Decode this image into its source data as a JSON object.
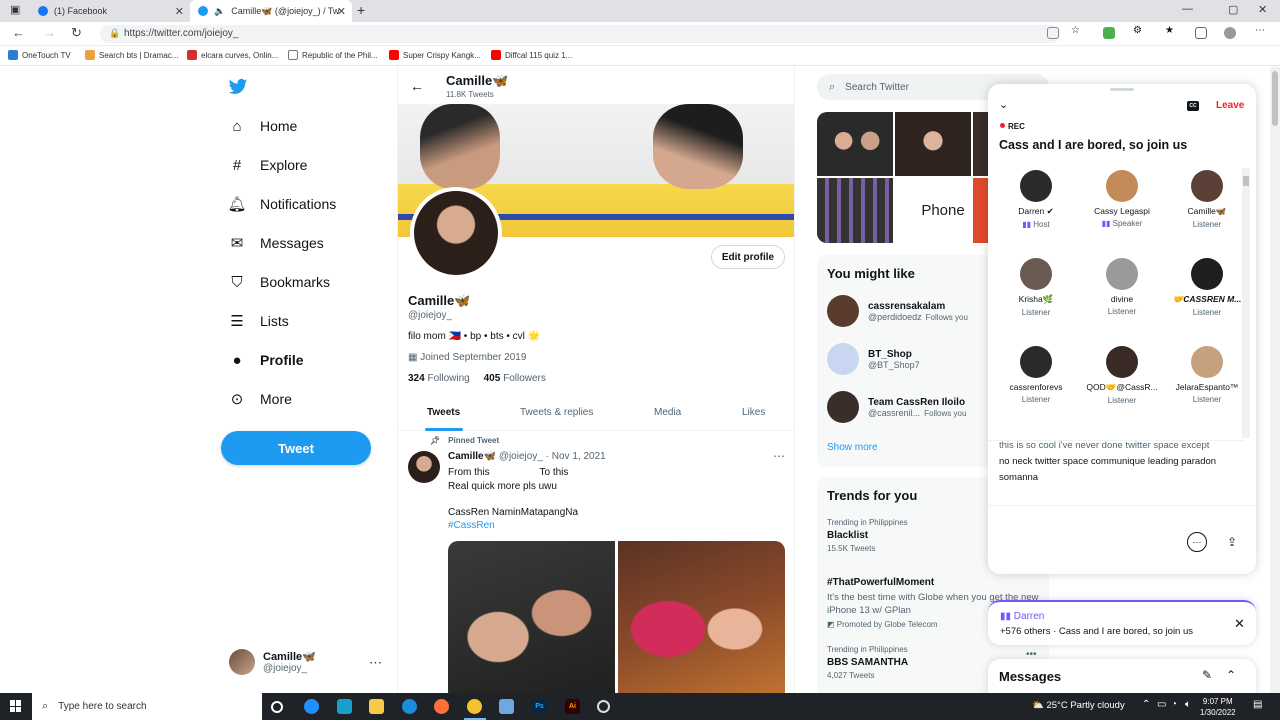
{
  "browser": {
    "tabs": [
      {
        "title": "(1) Facebook",
        "favicon_color": "#1877f2"
      },
      {
        "title": "Camille🦋 (@joiejoy_) / Tw",
        "favicon_color": "#1d9bf0",
        "active": true
      }
    ],
    "url": "https://twitter.com/joiejoy_",
    "bookmarks": [
      {
        "label": "OneTouch TV",
        "color": "#2e7cd6"
      },
      {
        "label": "Search bts | Dramac...",
        "color": "#e8a33c"
      },
      {
        "label": "elcara curves, Onlin...",
        "color": "#d62d2d"
      },
      {
        "label": "Republic of the Phil...",
        "color": "#777777"
      },
      {
        "label": "Super Crispy Kangk...",
        "color": "#ff0000"
      },
      {
        "label": "Diffcal 115 quiz 1...",
        "color": "#ff0000"
      }
    ]
  },
  "nav": {
    "items": [
      {
        "label": "Home",
        "icon": "home-icon"
      },
      {
        "label": "Explore",
        "icon": "hashtag-icon"
      },
      {
        "label": "Notifications",
        "icon": "bell-icon"
      },
      {
        "label": "Messages",
        "icon": "envelope-icon"
      },
      {
        "label": "Bookmarks",
        "icon": "bookmark-icon"
      },
      {
        "label": "Lists",
        "icon": "list-icon"
      },
      {
        "label": "Profile",
        "icon": "person-icon",
        "active": true
      },
      {
        "label": "More",
        "icon": "more-circle-icon"
      }
    ],
    "tweet_button": "Tweet",
    "account": {
      "name": "Camille🦋",
      "handle": "@joiejoy_"
    }
  },
  "profile": {
    "header_name": "Camille🦋",
    "tweet_count": "11.8K Tweets",
    "edit_button": "Edit profile",
    "name": "Camille🦋",
    "handle": "@joiejoy_",
    "bio": "filo mom 🇵🇭 • bp • bts • cvl 🌟",
    "joined": "Joined September 2019",
    "following_count": "324",
    "following_label": "Following",
    "followers_count": "405",
    "followers_label": "Followers",
    "tabs": [
      "Tweets",
      "Tweets & replies",
      "Media",
      "Likes"
    ]
  },
  "pinned_tweet": {
    "label": "Pinned Tweet",
    "name": "Camille🦋",
    "meta": "@joiejoy_ · Nov 1, 2021",
    "lines": [
      "From this                  To this",
      "Real quick more pls uwu",
      "",
      "CassRen NaminMatapangNa"
    ],
    "hashtag": "#CassRen"
  },
  "right": {
    "search_placeholder": "Search Twitter",
    "media_text": "Phone",
    "might_like": {
      "title": "You might like",
      "people": [
        {
          "name": "cassrensakalam",
          "handle": "@perdidoedz",
          "follows_you": "Follows you",
          "color": "#5a3b2e"
        },
        {
          "name": "BT_Shop",
          "handle": "@BT_Shop7",
          "follows_you": "",
          "color": "#c9d6f2"
        },
        {
          "name": "Team CassRen Iloilo",
          "handle": "@cassrenil...",
          "follows_you": "Follows you",
          "color": "#3a2e2a"
        }
      ],
      "show_more": "Show more"
    },
    "trends": {
      "title": "Trends for you",
      "items": [
        {
          "context": "Trending in Philippines",
          "name": "Blacklist",
          "count": "15.5K Tweets"
        },
        {
          "context": "",
          "name": "#ThatPowerfulMoment",
          "desc": "It's the best time with Globe when you get the new iPhone 13 w/ GPlan",
          "promo": "Promoted by Globe Telecom"
        },
        {
          "context": "Trending in Philippines",
          "name": "BBS SAMANTHA",
          "count": "4,027 Tweets"
        }
      ]
    }
  },
  "space": {
    "leave": "Leave",
    "cc": "CC",
    "rec": "REC",
    "title": "Cass and I are bored, so join us",
    "participants": [
      {
        "name": "Darren ✔",
        "role": "Host",
        "color": "#2b2b2b"
      },
      {
        "name": "Cassy Legaspi",
        "role": "Speaker",
        "color": "#c48a5a"
      },
      {
        "name": "Camille🦋",
        "role": "Listener",
        "color": "#5a4036"
      },
      {
        "name": "Krisha🌿",
        "role": "Listener",
        "color": "#6a5a52"
      },
      {
        "name": "divine",
        "role": "Listener",
        "color": "#9a9a9a"
      },
      {
        "name": "🤝CASSREN M...",
        "role": "Listener",
        "color": "#1f1f1f"
      },
      {
        "name": "cassrenforevs",
        "role": "Listener",
        "color": "#2a2a2a"
      },
      {
        "name": "QOD🤝@CassR...",
        "role": "Listener",
        "color": "#3a2a26"
      },
      {
        "name": "JelaraEspanto™",
        "role": "Listener",
        "color": "#c7a07e"
      }
    ],
    "caption1": "this is so cool i've never done twitter space except",
    "caption2": "no neck twitter space communique leading paradon somanna",
    "dock_host": "Darren",
    "dock_sub": "+576 others · Cass and I are bored, so join us"
  },
  "messages": {
    "title": "Messages"
  },
  "taskbar": {
    "search_placeholder": "Type here to search",
    "weather": "25°C  Partly cloudy",
    "time": "9:07 PM",
    "date": "1/30/2022"
  }
}
